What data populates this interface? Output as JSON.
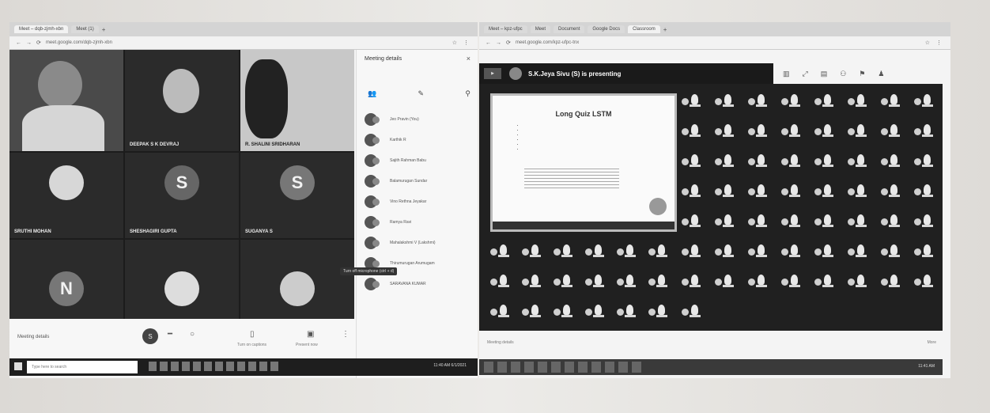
{
  "left": {
    "tabs": [
      "Meet – dqb-zjmh-xbn",
      "Meet (1)"
    ],
    "url": "meet.google.com/dqb-zjmh-xbn",
    "tiles": [
      {
        "name": "",
        "avatar": "video",
        "color": "#5a5a5a"
      },
      {
        "name": "DEEPAK S K DEVRAJ",
        "avatar": "photo",
        "color": "#bbbbbb"
      },
      {
        "name": "R. SHALINI SRIDHARAN",
        "avatar": "video2",
        "color": "#333"
      },
      {
        "name": "SRUTHI MOHAN",
        "avatar": "photo",
        "color": "#d7d7d7",
        "letter": ""
      },
      {
        "name": "SHESHAGIRI GUPTA",
        "avatar": "letter",
        "color": "#666",
        "letter": "S"
      },
      {
        "name": "SUGANYA S",
        "avatar": "letter",
        "color": "#777",
        "letter": "S"
      },
      {
        "name": "",
        "avatar": "letter",
        "color": "#777",
        "letter": "N"
      },
      {
        "name": "",
        "avatar": "photo",
        "color": "#ddd",
        "letter": ""
      },
      {
        "name": "",
        "avatar": "photo",
        "color": "#ccc",
        "letter": ""
      }
    ],
    "panel": {
      "title": "Meeting details",
      "close": "×",
      "participants": [
        "Jeo Pravin (You)",
        "Karthik R",
        "Sajith Rahman Babu",
        "Balamurugan Sundar",
        "Vino Rethna Jeyakar",
        "Ramya Ravi",
        "Mahalakshmi V (Lakshmi)",
        "Thirumurugan Arumugam",
        "SARAVANA KUMAR"
      ],
      "tooltip": "Turn off microphone (ctrl + d)"
    },
    "controls": {
      "details": "Meeting details",
      "avatar_letter": "S",
      "lbl_captions": "Turn on captions",
      "lbl_present": "Present now"
    },
    "taskbar": {
      "search": "Type here to search",
      "tray": "11:40 AM 6/1/2021"
    }
  },
  "right": {
    "tabs": [
      "Meet – kpz-ufpc",
      "Meet",
      "Document",
      "Google Docs",
      "Classroom"
    ],
    "url": "meet.google.com/kpz-ufpc-tnx",
    "header_title": "S.K.Jeya Sivu (S) is presenting",
    "slide": {
      "title": "Long Quiz LSTM",
      "bullets": [
        "",
        "",
        "",
        "",
        "",
        ""
      ],
      "subtitle": ""
    },
    "bottom": {
      "a": "Meeting details",
      "b": "",
      "c": "More"
    },
    "taskbar": {
      "tray": "11:41 AM"
    }
  }
}
